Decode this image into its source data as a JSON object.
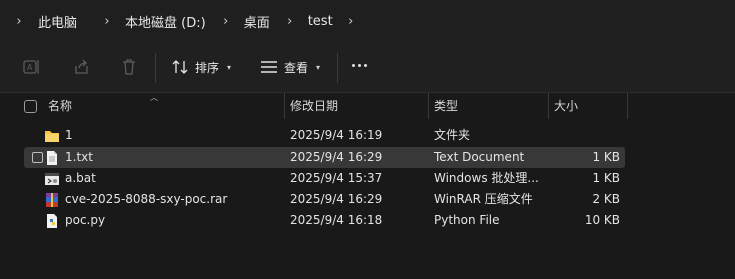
{
  "breadcrumb": {
    "items": [
      "此电脑",
      "本地磁盘 (D:)",
      "桌面",
      "test"
    ]
  },
  "toolbar": {
    "sort_label": "排序",
    "view_label": "查看"
  },
  "columns": {
    "name": "名称",
    "modified": "修改日期",
    "type": "类型",
    "size": "大小"
  },
  "files": [
    {
      "name": "1",
      "modified": "2025/9/4 16:19",
      "type": "文件夹",
      "size": "",
      "icon": "folder-icon"
    },
    {
      "name": "1.txt",
      "modified": "2025/9/4 16:29",
      "type": "Text Document",
      "size": "1 KB",
      "icon": "text-file-icon",
      "selected": true
    },
    {
      "name": "a.bat",
      "modified": "2025/9/4 15:37",
      "type": "Windows 批处理...",
      "size": "1 KB",
      "icon": "batch-file-icon"
    },
    {
      "name": "cve-2025-8088-sxy-poc.rar",
      "modified": "2025/9/4 16:29",
      "type": "WinRAR 压缩文件",
      "size": "2 KB",
      "icon": "rar-archive-icon"
    },
    {
      "name": "poc.py",
      "modified": "2025/9/4 16:18",
      "type": "Python File",
      "size": "10 KB",
      "icon": "python-file-icon"
    }
  ],
  "colors": {
    "background": "#191919",
    "selected_row": "#383838",
    "folder": "#f5c242",
    "accent": "#2b7de9"
  }
}
